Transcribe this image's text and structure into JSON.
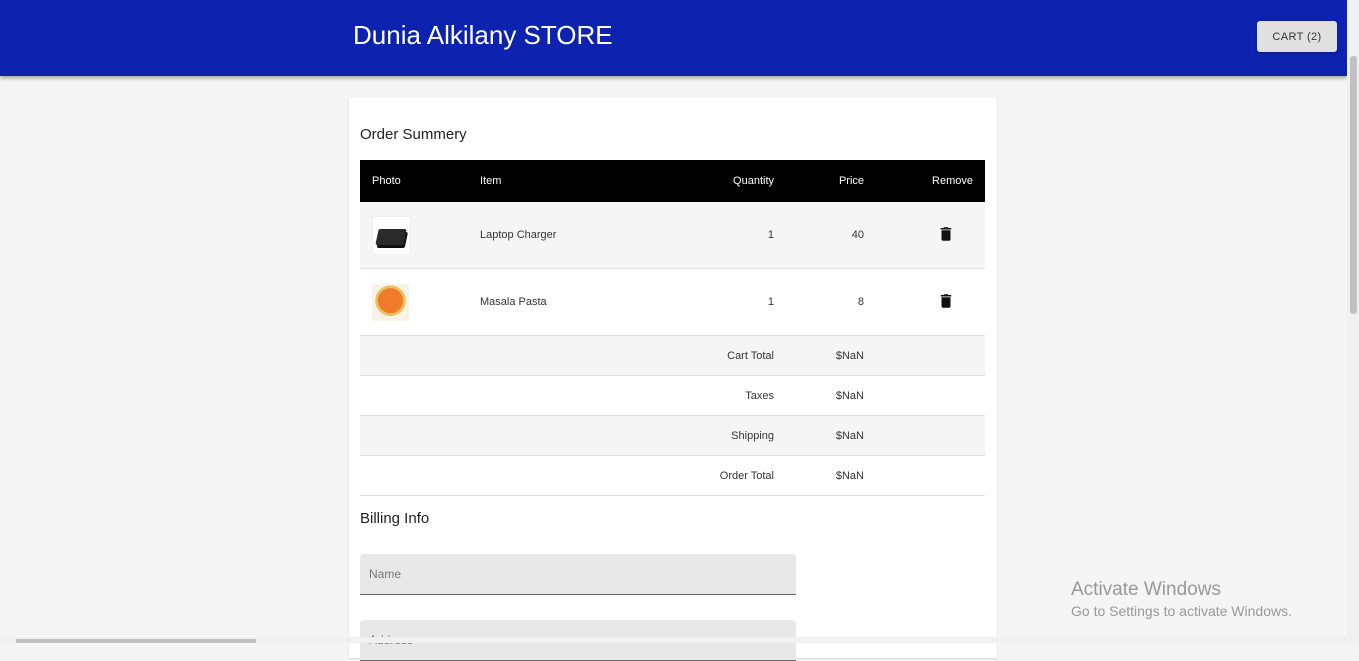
{
  "header": {
    "store_title": "Dunia Alkilany STORE",
    "cart_label": "CART (2)",
    "background_color": "#0d23b0"
  },
  "order_summary": {
    "title": "Order Summery",
    "columns": [
      "Photo",
      "Item",
      "Quantity",
      "Price",
      "Remove"
    ],
    "items": [
      {
        "photo_icon": "laptop-charger-thumbnail",
        "name": "Laptop Charger",
        "quantity": "1",
        "price": "40",
        "remove_icon": "trash-icon"
      },
      {
        "photo_icon": "masala-pasta-thumbnail",
        "name": "Masala Pasta",
        "quantity": "1",
        "price": "8",
        "remove_icon": "trash-icon"
      }
    ],
    "totals": [
      {
        "label": "Cart Total",
        "value": "$NaN"
      },
      {
        "label": "Taxes",
        "value": "$NaN"
      },
      {
        "label": "Shipping",
        "value": "$NaN"
      },
      {
        "label": "Order Total",
        "value": "$NaN"
      }
    ]
  },
  "billing": {
    "title": "Billing Info",
    "name_placeholder": "Name",
    "address_placeholder": "Address"
  },
  "watermark": {
    "title": "Activate Windows",
    "subtitle": "Go to Settings to activate Windows."
  }
}
